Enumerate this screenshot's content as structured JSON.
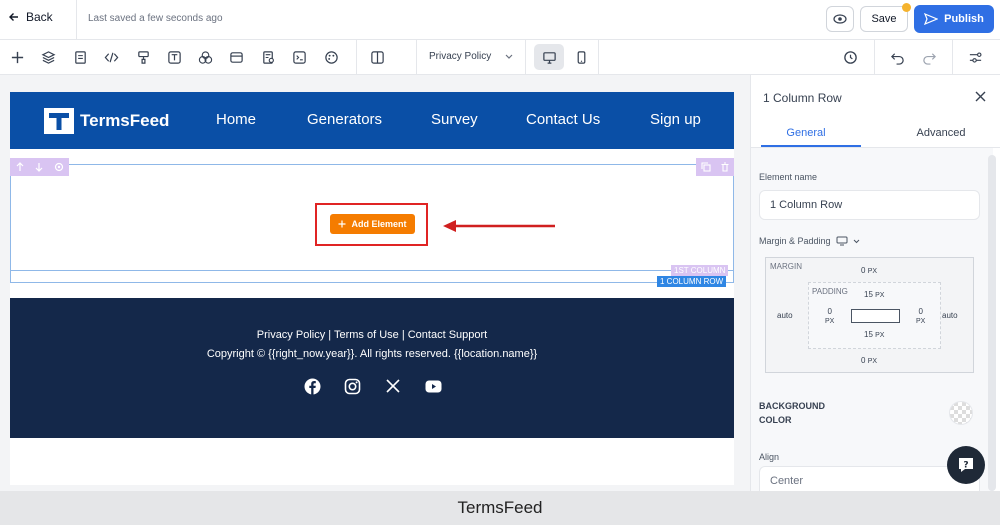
{
  "topbar": {
    "back_label": "Back",
    "saved_status": "Last saved a few seconds ago",
    "save_label": "Save",
    "publish_label": "Publish"
  },
  "toolbar": {
    "page_select": "Privacy Policy"
  },
  "site": {
    "logo_text": "TermsFeed",
    "nav": [
      "Home",
      "Generators",
      "Survey",
      "Contact Us",
      "Sign up"
    ],
    "add_element_label": "Add Element",
    "col_tag": "1ST COLUMN",
    "row_tag": "1 COLUMN ROW",
    "footer_links": "Privacy Policy | Terms of Use | Contact Support",
    "footer_copyright": "Copyright © {{right_now.year}}. All rights reserved. {{location.name}}",
    "footer_bg": "#14284a",
    "nav_bg": "#0a4fa6"
  },
  "panel": {
    "title": "1 Column Row",
    "tab_general": "General",
    "tab_advanced": "Advanced",
    "element_name_label": "Element name",
    "element_name_value": "1 Column Row",
    "margin_padding_label": "Margin & Padding",
    "margin_label": "MARGIN",
    "margin_top": "0",
    "margin_bottom": "0",
    "margin_left": "auto",
    "margin_right": "auto",
    "padding_label": "PADDING",
    "padding_top": "15",
    "padding_bottom": "15",
    "padding_left": "0",
    "padding_right": "0",
    "unit": "PX",
    "background_color_label": "BACKGROUND COLOR",
    "align_label": "Align",
    "align_value": "Center"
  },
  "caption": "TermsFeed",
  "colors": {
    "accent": "#2f6fe4",
    "add_button": "#f57c00",
    "highlight": "#e02424"
  }
}
